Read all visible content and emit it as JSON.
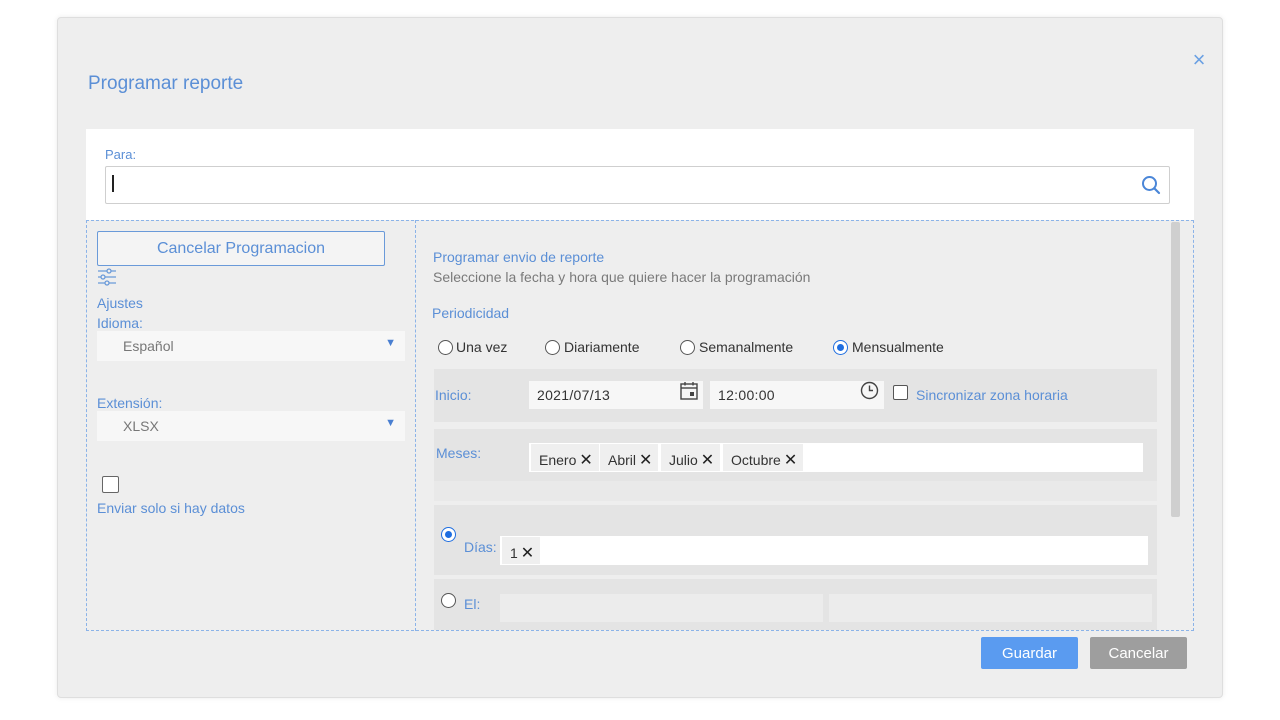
{
  "dialog": {
    "title": "Programar reporte",
    "close_symbol": "×"
  },
  "recipient": {
    "label": "Para:",
    "value": "",
    "search_icon": "search-icon"
  },
  "sidebar": {
    "cancel_schedule_label": "Cancelar Programacion",
    "settings_icon": "sliders-icon",
    "settings_label": "Ajustes",
    "language_label": "Idioma:",
    "language_value": "Español",
    "extension_label": "Extensión:",
    "extension_value": "XLSX",
    "send_only_if_data_label": "Enviar solo si hay datos",
    "send_only_if_data_checked": false
  },
  "schedule": {
    "heading": "Programar envio de reporte",
    "subheading": "Seleccione la fecha y hora que quiere hacer la programación",
    "periodicity_label": "Periodicidad",
    "options": [
      {
        "label": "Una vez",
        "selected": false
      },
      {
        "label": "Diariamente",
        "selected": false
      },
      {
        "label": "Semanalmente",
        "selected": false
      },
      {
        "label": "Mensualmente",
        "selected": true
      }
    ],
    "start_label": "Inicio:",
    "start_date": "2021/07/13",
    "start_time": "12:00:00",
    "sync_timezone_label": "Sincronizar zona horaria",
    "sync_timezone_checked": false,
    "months_label": "Meses:",
    "months": [
      "Enero",
      "Abril",
      "Julio",
      "Octubre"
    ],
    "days_label": "Días:",
    "days_selected": true,
    "days": [
      "1"
    ],
    "on_label": "El:",
    "on_selected": false,
    "remove_symbol": "✕"
  },
  "footer": {
    "save_label": "Guardar",
    "cancel_label": "Cancelar"
  },
  "colors": {
    "accent": "#5b8fd6",
    "primary_button": "#5a9bf0",
    "secondary_button": "#9e9e9e",
    "radio_selected": "#1f6ee0"
  }
}
